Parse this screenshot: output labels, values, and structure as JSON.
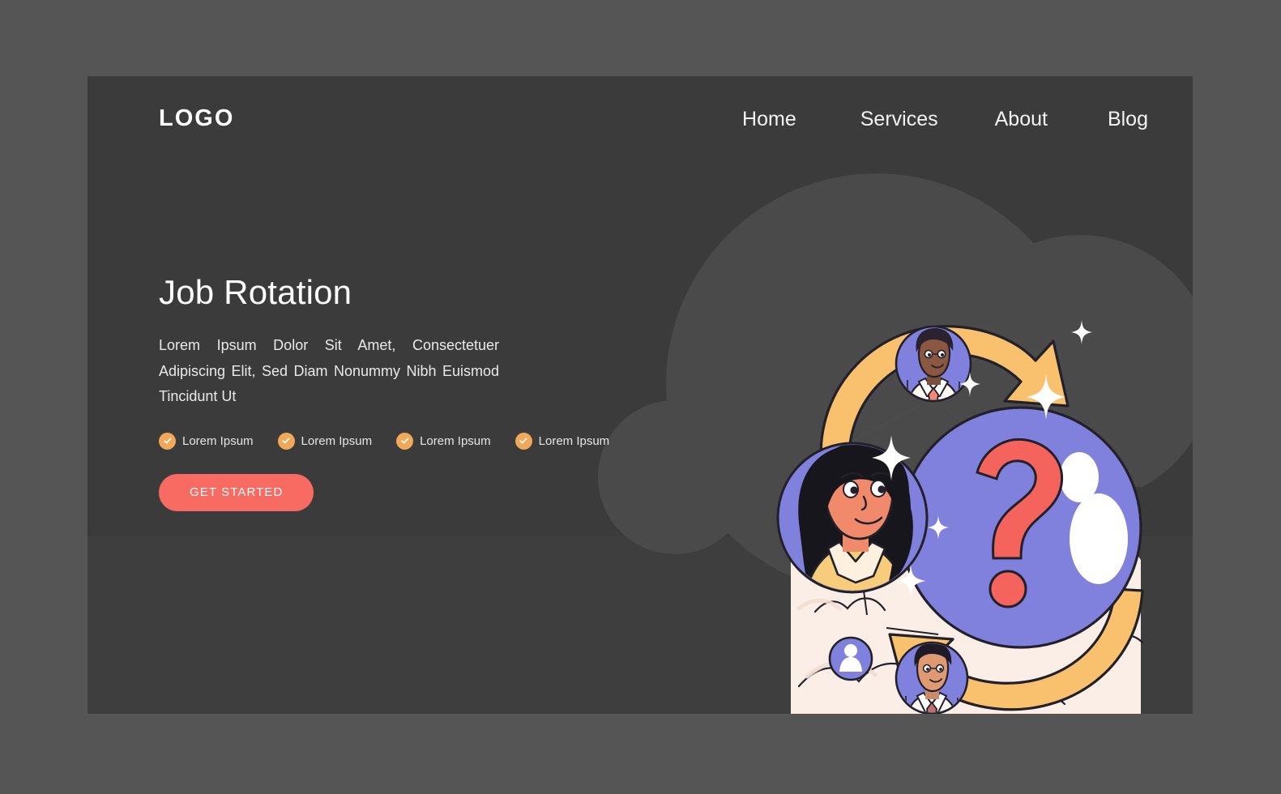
{
  "brand": {
    "logo_text": "LOGO"
  },
  "nav": {
    "items": [
      {
        "label": "Home",
        "name": "nav-item-home"
      },
      {
        "label": "Services",
        "name": "nav-item-services"
      },
      {
        "label": "About",
        "name": "nav-item-about"
      },
      {
        "label": "Blog",
        "name": "nav-item-blog"
      }
    ]
  },
  "hero": {
    "title": "Job Rotation",
    "subtitle": "Lorem Ipsum Dolor Sit Amet, Consectetuer Adipiscing Elit, Sed Diam Nonummy Nibh Euismod Tincidunt Ut",
    "features": [
      {
        "label": "Lorem Ipsum",
        "icon": "check-circle-icon"
      },
      {
        "label": "Lorem Ipsum",
        "icon": "check-circle-icon"
      },
      {
        "label": "Lorem Ipsum",
        "icon": "check-circle-icon"
      },
      {
        "label": "Lorem Ipsum",
        "icon": "check-circle-icon"
      }
    ],
    "cta_label": "GET STARTED"
  },
  "illustration": {
    "name": "job-rotation-illustration",
    "elements": [
      {
        "name": "rotation-arrow-top",
        "icon": "curved-arrow-right-icon"
      },
      {
        "name": "rotation-arrow-bottom",
        "icon": "curved-arrow-left-icon"
      },
      {
        "name": "question-mark-sphere",
        "icon": "question-mark-icon"
      },
      {
        "name": "avatar-woman",
        "icon": "avatar-icon"
      },
      {
        "name": "avatar-man-top",
        "icon": "avatar-icon"
      },
      {
        "name": "avatar-man-bottom",
        "icon": "avatar-icon"
      },
      {
        "name": "person-node-icon",
        "icon": "user-circle-icon"
      },
      {
        "name": "sparkle-decoration",
        "icon": "sparkle-icon"
      }
    ]
  },
  "colors": {
    "page_background": "#555555",
    "card_background": "#3e3e3e",
    "hero_panel": "#3b3b3b",
    "cloud_blob": "#4a4a4a",
    "accent_red": "#f86b63",
    "accent_orange": "#efa959",
    "accent_amber": "#f9c06e",
    "accent_purple": "#8080dd",
    "cream_panel": "#fbeee6",
    "text_light": "#ffffff",
    "ink": "#22202a"
  }
}
